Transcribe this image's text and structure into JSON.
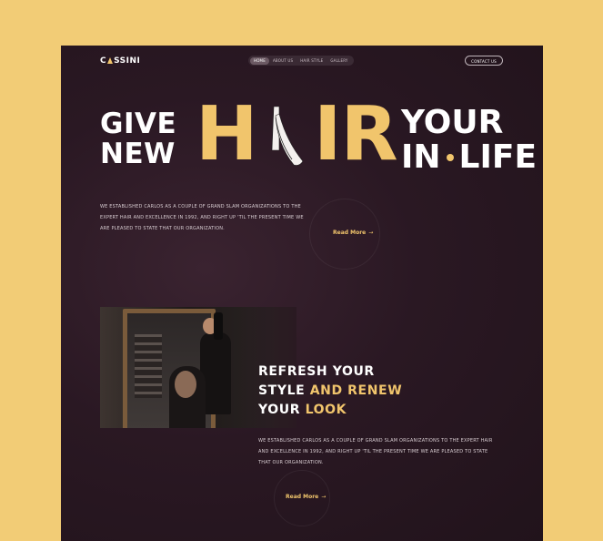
{
  "brand": {
    "logo_prefix": "C",
    "logo_suffix": "SSINI"
  },
  "nav": {
    "items": [
      "HOME",
      "ABOUT US",
      "HAIR STYLE",
      "GALLERY"
    ],
    "active": "HOME"
  },
  "header": {
    "contact_label": "CONTACT US"
  },
  "hero": {
    "left_top": "GIVE",
    "left_bottom": "NEW",
    "big_h": "H",
    "big_ir": "IR",
    "right_top": "YOUR",
    "right_bottom_a": "IN",
    "right_bottom_b": "LIFE",
    "intro": "WE ESTABLISHED CARLOS AS A COUPLE OF GRAND SLAM ORGANIZATIONS TO THE EXPERT HAIR AND EXCELLENCE IN 1992, AND RIGHT UP 'TIL THE PRESENT TIME WE ARE PLEASED TO STATE THAT OUR ORGANIZATION.",
    "read_more": "Read More"
  },
  "section2": {
    "h_line1_white": "REFRESH YOUR",
    "h_line2_white": "STYLE ",
    "h_line2_gold": "AND RENEW",
    "h_line3_white": "YOUR ",
    "h_line3_gold": "LOOK",
    "body": "WE ESTABLISHED CARLOS AS A COUPLE OF GRAND SLAM ORGANIZATIONS TO THE EXPERT HAIR AND EXCELLENCE IN 1992, AND RIGHT UP 'TIL THE PRESENT TIME WE ARE PLEASED TO STATE THAT OUR ORGANIZATION.",
    "read_more": "Read More"
  },
  "colors": {
    "accent": "#f1c56c",
    "background": "#f2cc76",
    "page": "#2a1823"
  },
  "icons": {
    "razor": "razor-icon",
    "arrow": "arrow-right-icon"
  }
}
